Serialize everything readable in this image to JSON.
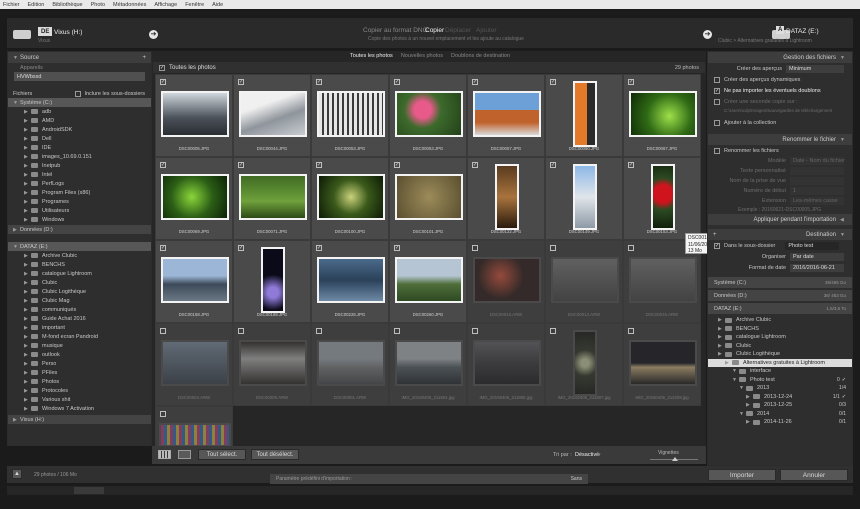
{
  "menu": [
    "Fichier",
    "Edition",
    "Bibliothèque",
    "Photo",
    "Métadonnées",
    "Affichage",
    "Fenêtre",
    "Aide"
  ],
  "top": {
    "source_badge": "DE",
    "source_label": "Vixus (H:)",
    "source_sub": "Vixus",
    "modes": [
      "Copier au format DNG",
      "Copier",
      "Déplacer",
      "Ajouter"
    ],
    "mode_sub": "Copie des photos à un nouvel emplacement et les ajoute au catalogue",
    "dest_badge": "À",
    "dest_label": "DATAZ (E:)",
    "dest_sub": "Clubic > Alternatives gratuites à Lightroom"
  },
  "left": {
    "title": "Source",
    "recent_label": "Appareils",
    "recent_value": "HVWbssd",
    "files_label": "Fichiers",
    "include_sub": "Inclure les sous-dossiers",
    "system_drive": "Système (C:)",
    "system_folders": [
      "adb",
      "AMD",
      "AndroidSDK",
      "Dell",
      "IDE",
      "images_10.69.0.151",
      "Inetpub",
      "Intel",
      "PerfLogs",
      "Program Files (x86)",
      "Programes",
      "Utilisateurs",
      "Windows"
    ],
    "data_drive": "Données (D:)",
    "dataz_drive": "DATAZ (E:)",
    "dataz_folders": [
      "Archive Clubic",
      "BENCHS",
      "catalogue Lightroom",
      "Clubic",
      "Clubic Logithèque",
      "Clubic Mag",
      "communiqués",
      "Guide Achat 2016",
      "important",
      "M-fond ecran Pandroid",
      "musique",
      "outlook",
      "Perso",
      "PFiles",
      "Photos",
      "Protocoles",
      "Various shit",
      "Windows 7 Activation"
    ],
    "vixus_drive": "Vixus (H:)"
  },
  "center": {
    "tabs": [
      "Toutes les photos",
      "Nouvelles photos",
      "Doublons de destination"
    ],
    "all_label": "Toutes les photos",
    "count_label": "29 photos",
    "sort_label": "Tri par :",
    "sort_value": "Désactivé",
    "thumb_label": "Vignettes",
    "check_all": "Tout sélect.",
    "uncheck_all": "Tout désélect.",
    "photos": [
      {
        "name": "DSC00005.JPG",
        "checked": true,
        "kind": "bikes"
      },
      {
        "name": "DSC00044.JPG",
        "checked": true,
        "kind": "arch"
      },
      {
        "name": "DSC00053.JPG",
        "checked": true,
        "kind": "rail"
      },
      {
        "name": "DSC00053.JPG",
        "checked": true,
        "kind": "flowers"
      },
      {
        "name": "DSC00057.JPG",
        "checked": true,
        "kind": "build"
      },
      {
        "name": "DSC00060.JPG",
        "checked": true,
        "kind": "orange"
      },
      {
        "name": "DSC00067.JPG",
        "checked": true,
        "kind": "green"
      },
      {
        "name": "DSC00069.JPG",
        "checked": true,
        "kind": "green2"
      },
      {
        "name": "DSC00071.JPG",
        "checked": true,
        "kind": "grass"
      },
      {
        "name": "DSC00100.JPG",
        "checked": true,
        "kind": "plant"
      },
      {
        "name": "DSC00101.JPG",
        "checked": true,
        "kind": "moss"
      },
      {
        "name": "DSC00122.JPG",
        "checked": true,
        "kind": "window"
      },
      {
        "name": "DSC00149.JPG",
        "checked": true,
        "kind": "tower"
      },
      {
        "name": "DSC00153.JPG",
        "checked": true,
        "kind": "rose"
      },
      {
        "name": "DSC00158.JPG",
        "checked": true,
        "kind": "city"
      },
      {
        "name": "DSC00188.JPG",
        "checked": true,
        "kind": "night"
      },
      {
        "name": "DSC00226.JPG",
        "checked": true,
        "kind": "swan"
      },
      {
        "name": "DSC00260.JPG",
        "checked": true,
        "kind": "hill"
      },
      {
        "name": "DSC00013.ARW",
        "checked": false,
        "kind": "dark"
      },
      {
        "name": "DSC00014.ARW",
        "checked": false,
        "kind": "grey"
      },
      {
        "name": "DSC00016.ARW",
        "checked": false,
        "kind": "grey"
      },
      {
        "name": "DSC00004.ARW",
        "checked": false,
        "kind": "bluegrey"
      },
      {
        "name": "DSC00009.ARW",
        "checked": false,
        "kind": "sign"
      },
      {
        "name": "DSC00001.ARW",
        "checked": false,
        "kind": "bldg"
      },
      {
        "name": "IMG_20160406_211804.jpg",
        "checked": false,
        "kind": "water"
      },
      {
        "name": "IMG_20160406_211806.jpg",
        "checked": false,
        "kind": "dusk"
      },
      {
        "name": "IMG_20160406_211807.jpg",
        "checked": false,
        "kind": "glow"
      },
      {
        "name": "IMG_20160406_212208.jpg",
        "checked": false,
        "kind": "nightcity"
      },
      {
        "name": "",
        "checked": false,
        "kind": "stripes"
      }
    ],
    "tooltip": [
      "DSC00153.JPG",
      "11/06/2016 14:16:08 (9 y a 9 jours)",
      "13 Mo"
    ]
  },
  "right": {
    "file_mgmt": "Gestion des fichiers",
    "previews_label": "Créer des aperçus",
    "previews_value": "Minimum",
    "smart_previews": "Créer des aperçus dynamiques",
    "no_dupes": "Ne pas importer les éventuels doublons",
    "second_copy": "Créer une seconde copie sur :",
    "second_copy_path": "C:\\Users\\cdp\\Images\\Sauvegardes de téléchargement",
    "add_collection": "Ajouter à la collection",
    "rename": "Renommer le fichier",
    "rename_check": "Renommer les fichiers",
    "rename_rows": [
      [
        "Modèle",
        "Date - Nom du fichier"
      ],
      [
        "Texte personnalisé",
        ""
      ],
      [
        "Nom de la prise de vue",
        ""
      ],
      [
        "Numéro de début",
        "1"
      ],
      [
        "Extension",
        "Les-mêmes casse"
      ]
    ],
    "rename_sample": "Exemple : 20160621-DSC00005.JPG",
    "apply_during": "Appliquer pendant l'importation",
    "destination": "Destination",
    "into_sub": "Dans le sous-dossier",
    "sub_value": "Photo test",
    "organise": "Organiser",
    "organise_value": "Par date",
    "date_format": "Format de date",
    "date_value": "2016/2016-06-21",
    "drives": [
      [
        "Système (C:)",
        "39/465 Go"
      ],
      [
        "Données (D:)",
        "36/ 463 Go"
      ],
      [
        "DATAZ (E:)",
        "1,5/3,6 To"
      ]
    ],
    "tree": [
      {
        "label": "Archive Clubic",
        "lvl": 0,
        "count": ""
      },
      {
        "label": "BENCHS",
        "lvl": 0,
        "count": ""
      },
      {
        "label": "catalogue Lightroom",
        "lvl": 0,
        "count": ""
      },
      {
        "label": "Clubic",
        "lvl": 0,
        "count": ""
      },
      {
        "label": "Clubic Logithèque",
        "lvl": 0,
        "count": ""
      },
      {
        "label": "Alternatives gratuites à Lightroom",
        "lvl": 1,
        "count": "",
        "sel": true
      },
      {
        "label": "interface",
        "lvl": 2,
        "count": ""
      },
      {
        "label": "Photo test",
        "lvl": 2,
        "count": "0",
        "check": true
      },
      {
        "label": "2013",
        "lvl": 3,
        "count": "1/4"
      },
      {
        "label": "2013-12-24",
        "lvl": 4,
        "count": "1/1",
        "check": true
      },
      {
        "label": "2013-12-25",
        "lvl": 4,
        "count": "0/3"
      },
      {
        "label": "2014",
        "lvl": 3,
        "count": "0/1"
      },
      {
        "label": "2014-11-26",
        "lvl": 4,
        "count": "0/1"
      }
    ],
    "import": "Importer",
    "cancel": "Annuler"
  },
  "bottom": {
    "summary": "29 photos / 106 Mo",
    "preset_label": "Paramètre prédéfini d'importation :",
    "preset_value": "Sans"
  }
}
